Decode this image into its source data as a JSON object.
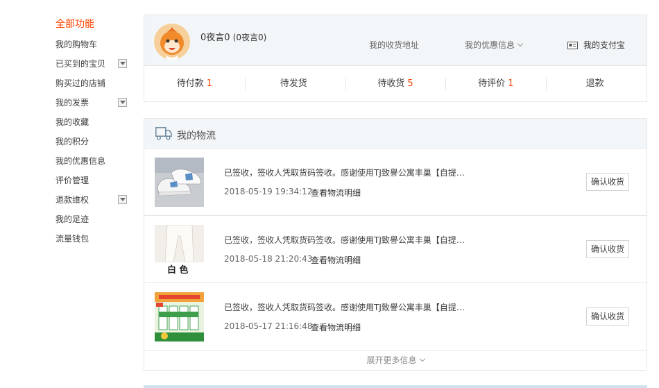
{
  "sidebar": {
    "title": "全部功能",
    "items": [
      {
        "label": "我的购物车"
      },
      {
        "label": "已买到的宝贝"
      },
      {
        "label": "购买过的店铺"
      },
      {
        "label": "我的发票"
      },
      {
        "label": "我的收藏"
      },
      {
        "label": "我的积分"
      },
      {
        "label": "我的优惠信息"
      },
      {
        "label": "评价管理"
      },
      {
        "label": "退款维权"
      },
      {
        "label": "我的足迹"
      },
      {
        "label": "流量钱包"
      }
    ]
  },
  "user": {
    "nickname": "0夜言0",
    "sub_nickname": "(0夜言0)",
    "links": {
      "address": "我的收货地址",
      "promo": "我的优惠信息",
      "alipay": "我的支付宝"
    }
  },
  "orders": [
    {
      "label": "待付款",
      "count": "1"
    },
    {
      "label": "待发货",
      "count": ""
    },
    {
      "label": "待收货",
      "count": "5"
    },
    {
      "label": "待评价",
      "count": "1"
    },
    {
      "label": "退款",
      "count": ""
    }
  ],
  "logistics": {
    "title": "我的物流",
    "items": [
      {
        "desc": "已签收，签收人凭取货码签收。感谢使用TJ致譽公寓丰巢【自提…",
        "time": "2018-05-19 19:34:12",
        "detail": "查看物流明细",
        "button": "确认收货"
      },
      {
        "desc": "已签收，签收人凭取货码签收。感谢使用TJ致譽公寓丰巢【自提…",
        "time": "2018-05-18 21:20:43",
        "detail": "查看物流明细",
        "button": "确认收货",
        "thumb_text": "白 色"
      },
      {
        "desc": "已签收，签收人凭取货码签收。感谢使用TJ致譽公寓丰巢【自提…",
        "time": "2018-05-17 21:16:48",
        "detail": "查看物流明细",
        "button": "确认收货"
      }
    ],
    "more": "展开更多信息"
  },
  "colors": {
    "accent": "#ff4400",
    "panel_bg": "#f3f6f8",
    "border": "#e6e6e6"
  }
}
